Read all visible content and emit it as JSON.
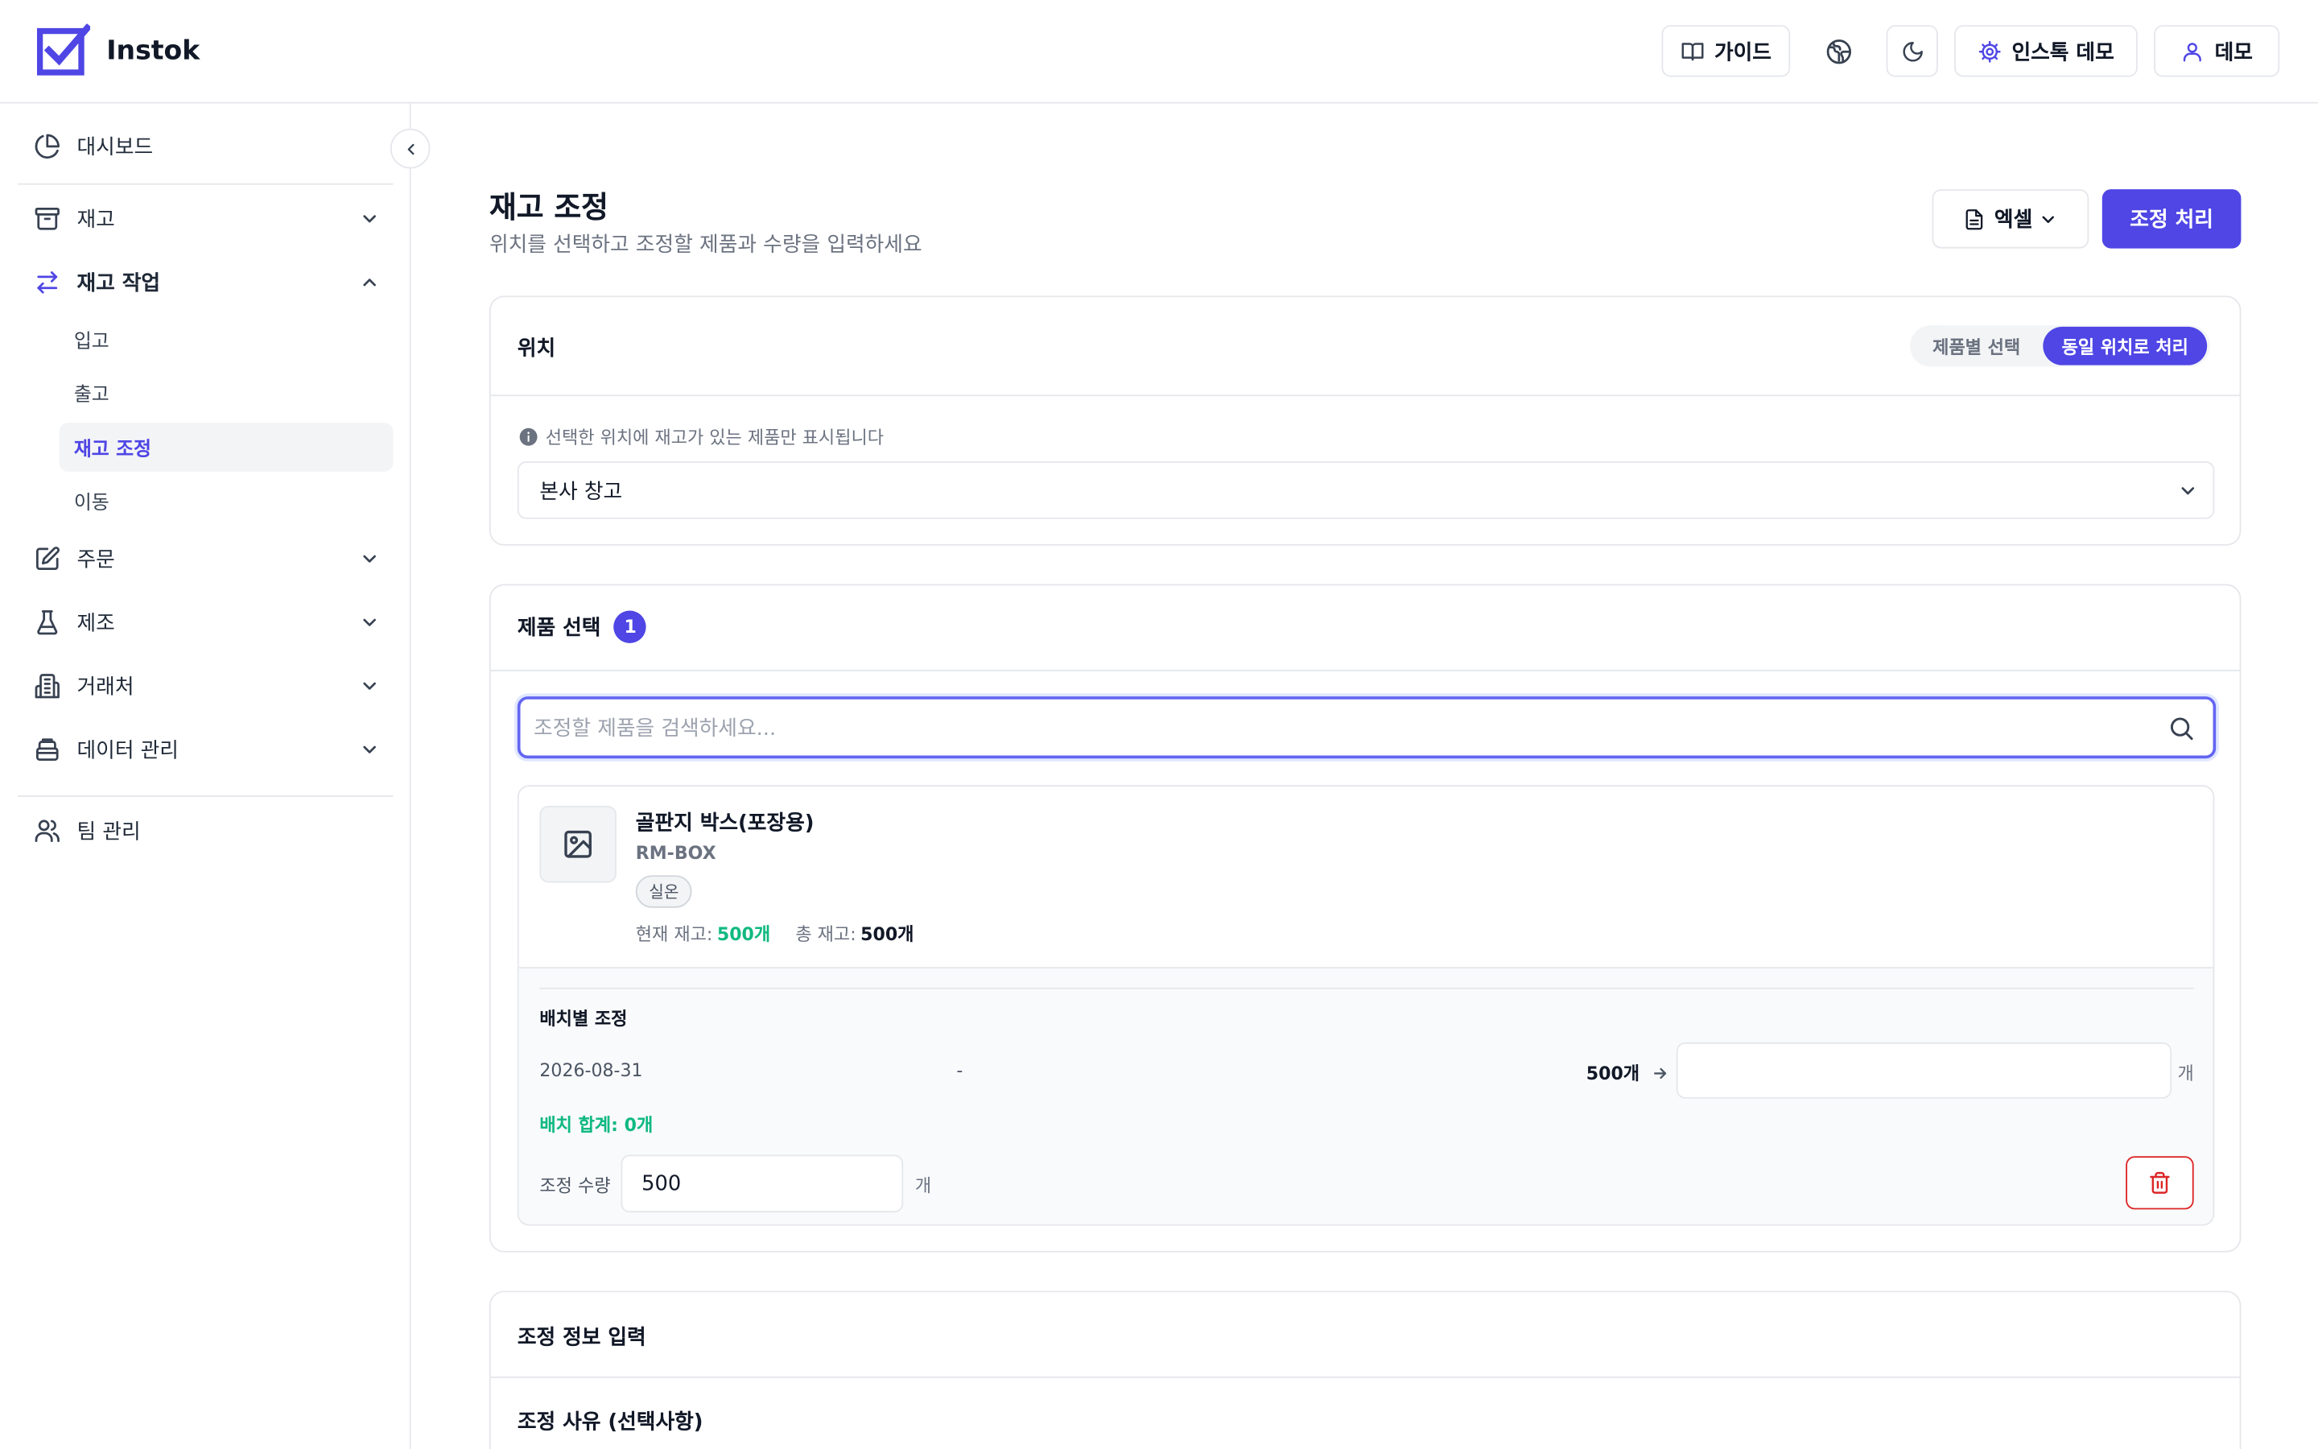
{
  "app": {
    "name": "Instok",
    "brand_color": "#4f46e5"
  },
  "header": {
    "guide_label": "가이드",
    "settings_label": "인스톡 데모",
    "user_label": "데모"
  },
  "sidebar": {
    "dashboard": "대시보드",
    "inventory": "재고",
    "inventory_ops": "재고 작업",
    "sub_items": [
      "입고",
      "출고",
      "재고 조정",
      "이동"
    ],
    "orders": "주문",
    "manufacturing": "제조",
    "partners": "거래처",
    "data_mgmt": "데이터 관리",
    "team": "팀 관리"
  },
  "page": {
    "title": "재고 조정",
    "subtitle": "위치를 선택하고 조정할 제품과 수량을 입력하세요",
    "excel_label": "엑셀",
    "submit_label": "조정 처리"
  },
  "location": {
    "title": "위치",
    "mode_by_product": "제품별 선택",
    "mode_same_location": "동일 위치로 처리",
    "info": "선택한 위치에 재고가 있는 제품만 표시됩니다",
    "selected": "본사 창고"
  },
  "products": {
    "title": "제품 선택",
    "count": "1",
    "search_placeholder": "조정할 제품을 검색하세요...",
    "item": {
      "name": "골판지 박스(포장용)",
      "sku": "RM-BOX",
      "tag": "실온",
      "current_label": "현재 재고:",
      "current_value": "500개",
      "total_label": "총 재고:",
      "total_value": "500개"
    },
    "batch": {
      "title": "배치별 조정",
      "date": "2026-08-31",
      "dash": "-",
      "qty": "500개",
      "unit": "개",
      "sum": "배치 합계: 0개"
    },
    "adjust_label": "조정 수량",
    "adjust_value": "500",
    "adjust_unit": "개"
  },
  "adjust_info": {
    "title": "조정 정보 입력",
    "reason_label": "조정 사유 (선택사항)"
  }
}
